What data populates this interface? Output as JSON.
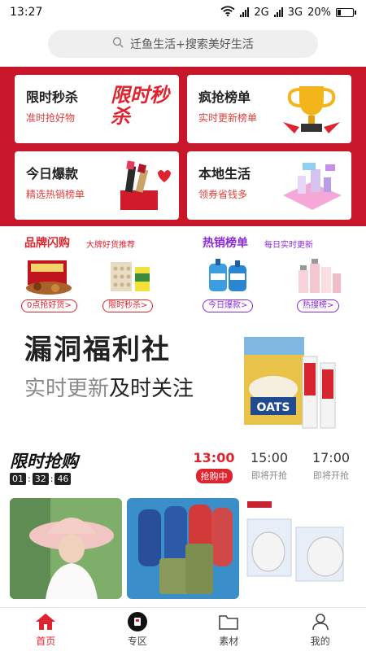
{
  "status_bar": {
    "time": "13:27",
    "net1": "2G",
    "net2": "3G",
    "battery": "20%"
  },
  "search": {
    "placeholder": "迁鱼生活+搜索美好生活"
  },
  "tiles": [
    {
      "title": "限时秒杀",
      "subtitle": "准时抢好物",
      "art_text": "限时秒杀"
    },
    {
      "title": "疯抢榜单",
      "subtitle": "实时更新榜单"
    },
    {
      "title": "今日爆款",
      "subtitle": "精选热销榜单"
    },
    {
      "title": "本地生活",
      "subtitle": "领券省钱多"
    }
  ],
  "promo": {
    "left": {
      "title": "品牌闪购",
      "subtitle": "大牌好货推荐",
      "pills": [
        "0点抢好货>",
        "限时秒杀>"
      ]
    },
    "right": {
      "title": "热销榜单",
      "subtitle": "每日实时更新",
      "pills": [
        "今日爆款>",
        "热搜榜>"
      ]
    }
  },
  "banner": {
    "title": "漏洞福利社",
    "sub_grey": "实时更新",
    "sub_dark": "及时关注",
    "product_text": "OATS"
  },
  "flash": {
    "title": "限时抢购",
    "countdown": [
      "01",
      "32",
      "46"
    ],
    "slots": [
      {
        "time": "13:00",
        "status": "抢购中"
      },
      {
        "time": "15:00",
        "status": "即将开抢"
      },
      {
        "time": "17:00",
        "status": "即将开抢"
      }
    ]
  },
  "tabbar": [
    {
      "label": "首页",
      "icon": "home-icon"
    },
    {
      "label": "专区",
      "icon": "zone-icon"
    },
    {
      "label": "素材",
      "icon": "folder-icon"
    },
    {
      "label": "我的",
      "icon": "user-icon"
    }
  ],
  "colors": {
    "brand_red": "#c8162a",
    "accent_red": "#e0242f",
    "promo_purple": "#8a2ad6"
  }
}
